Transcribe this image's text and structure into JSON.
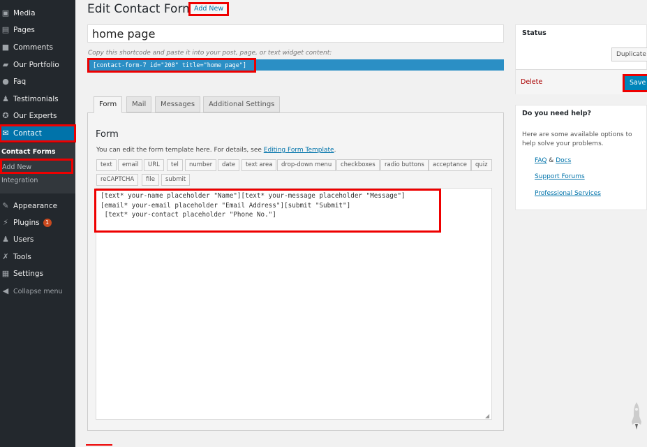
{
  "sidebar": {
    "items": [
      {
        "label": "Media",
        "icon": "media-icon"
      },
      {
        "label": "Pages",
        "icon": "pages-icon"
      },
      {
        "label": "Comments",
        "icon": "comments-icon"
      },
      {
        "label": "Our Portfolio",
        "icon": "folder-icon"
      },
      {
        "label": "Faq",
        "icon": "question-icon"
      },
      {
        "label": "Testimonials",
        "icon": "person-icon"
      },
      {
        "label": "Our Experts",
        "icon": "award-icon"
      },
      {
        "label": "Contact",
        "icon": "envelope-icon"
      },
      {
        "label": "Appearance",
        "icon": "brush-icon"
      },
      {
        "label": "Plugins",
        "icon": "plugin-icon",
        "badge": "1"
      },
      {
        "label": "Users",
        "icon": "users-icon"
      },
      {
        "label": "Tools",
        "icon": "wrench-icon"
      },
      {
        "label": "Settings",
        "icon": "settings-icon"
      },
      {
        "label": "Collapse menu",
        "icon": "collapse-icon"
      }
    ],
    "submenu": {
      "header": "Contact Forms",
      "add_new": "Add New",
      "integration": "Integration"
    }
  },
  "header": {
    "title": "Edit Contact Form",
    "add_new": "Add New"
  },
  "form_title": "home page",
  "shortcode": {
    "label": "Copy this shortcode and paste it into your post, page, or text widget content:",
    "value": "[contact-form-7 id=\"208\" title=\"home page\"]"
  },
  "tabs": [
    "Form",
    "Mail",
    "Messages",
    "Additional Settings"
  ],
  "form_panel": {
    "heading": "Form",
    "desc": "You can edit the form template here. For details, see ",
    "desc_link": "Editing Form Template",
    "desc_end": ".",
    "tags": [
      "text",
      "email",
      "URL",
      "tel",
      "number",
      "date",
      "text area",
      "drop-down menu",
      "checkboxes",
      "radio buttons",
      "acceptance",
      "quiz",
      "reCAPTCHA",
      "file",
      "submit"
    ],
    "template": "[text* your-name placeholder \"Name\"][text* your-message placeholder \"Message\"]\n[email* your-email placeholder \"Email Address\"][submit \"Submit\"]\n [text* your-contact placeholder \"Phone No.\"]"
  },
  "status": {
    "title": "Status",
    "duplicate": "Duplicate",
    "delete": "Delete",
    "save": "Save"
  },
  "help": {
    "title": "Do you need help?",
    "text": "Here are some available options to help solve your problems.",
    "faq": "FAQ",
    "amp": " & ",
    "docs": "Docs",
    "forums": "Support Forums",
    "services": "Professional Services"
  },
  "colors": {
    "accent": "#0073aa",
    "highlight": "#ee0000",
    "sidebar": "#23282d"
  }
}
